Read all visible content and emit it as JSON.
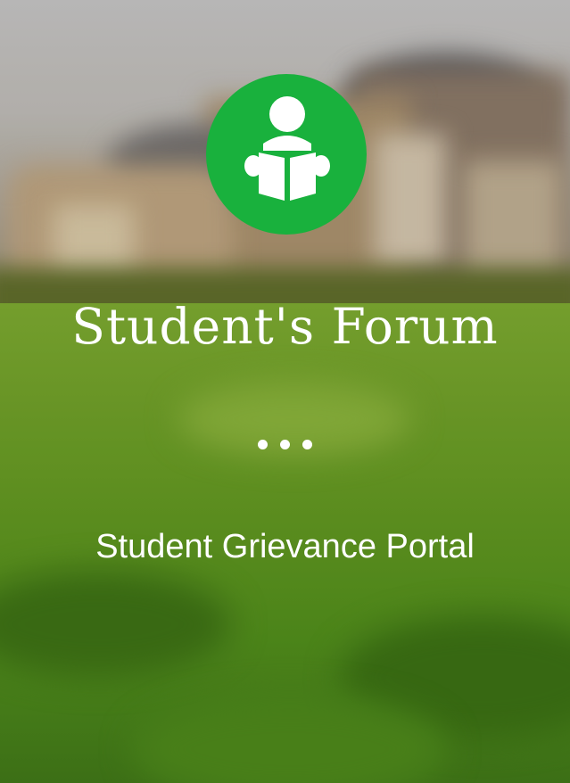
{
  "app": {
    "title": "Student's Forum",
    "subtitle": "Student Grievance Portal"
  },
  "logo": {
    "icon": "student-reading-book-icon",
    "background_color": "#19b13d"
  },
  "indicator": {
    "icon": "ellipsis-dots-icon",
    "dot_count": 3
  },
  "colors": {
    "text": "#ffffff",
    "accent": "#19b13d"
  }
}
